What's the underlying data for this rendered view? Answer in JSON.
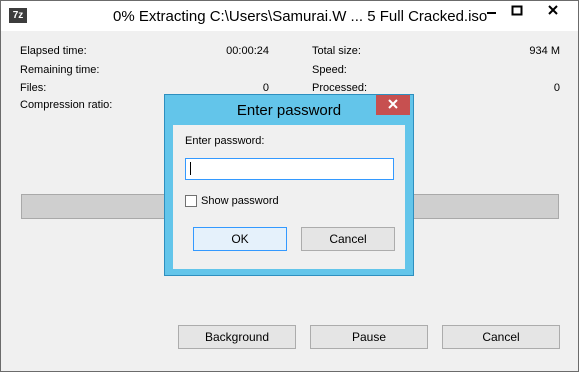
{
  "window": {
    "title": "0% Extracting C:\\Users\\Samurai.W ... 5 Full Cracked.iso",
    "app_icon_text": "7z"
  },
  "stats": {
    "elapsed_label": "Elapsed time:",
    "elapsed_value": "00:00:24",
    "remaining_label": "Remaining time:",
    "files_label": "Files:",
    "files_value": "0",
    "compression_label": "Compression ratio:",
    "total_size_label": "Total size:",
    "total_size_value": "934 M",
    "speed_label": "Speed:",
    "processed_label": "Processed:",
    "processed_value": "0"
  },
  "progress": {
    "percent": 0
  },
  "buttons": {
    "background": "Background",
    "pause": "Pause",
    "cancel": "Cancel"
  },
  "dialog": {
    "title": "Enter password",
    "field_label": "Enter password:",
    "password_value": "",
    "show_password_label": "Show password",
    "show_password_checked": false,
    "ok": "OK",
    "cancel": "Cancel"
  },
  "colors": {
    "dialog_frame": "#63c5ea",
    "close_red": "#c75050",
    "input_focus": "#3399ff"
  }
}
